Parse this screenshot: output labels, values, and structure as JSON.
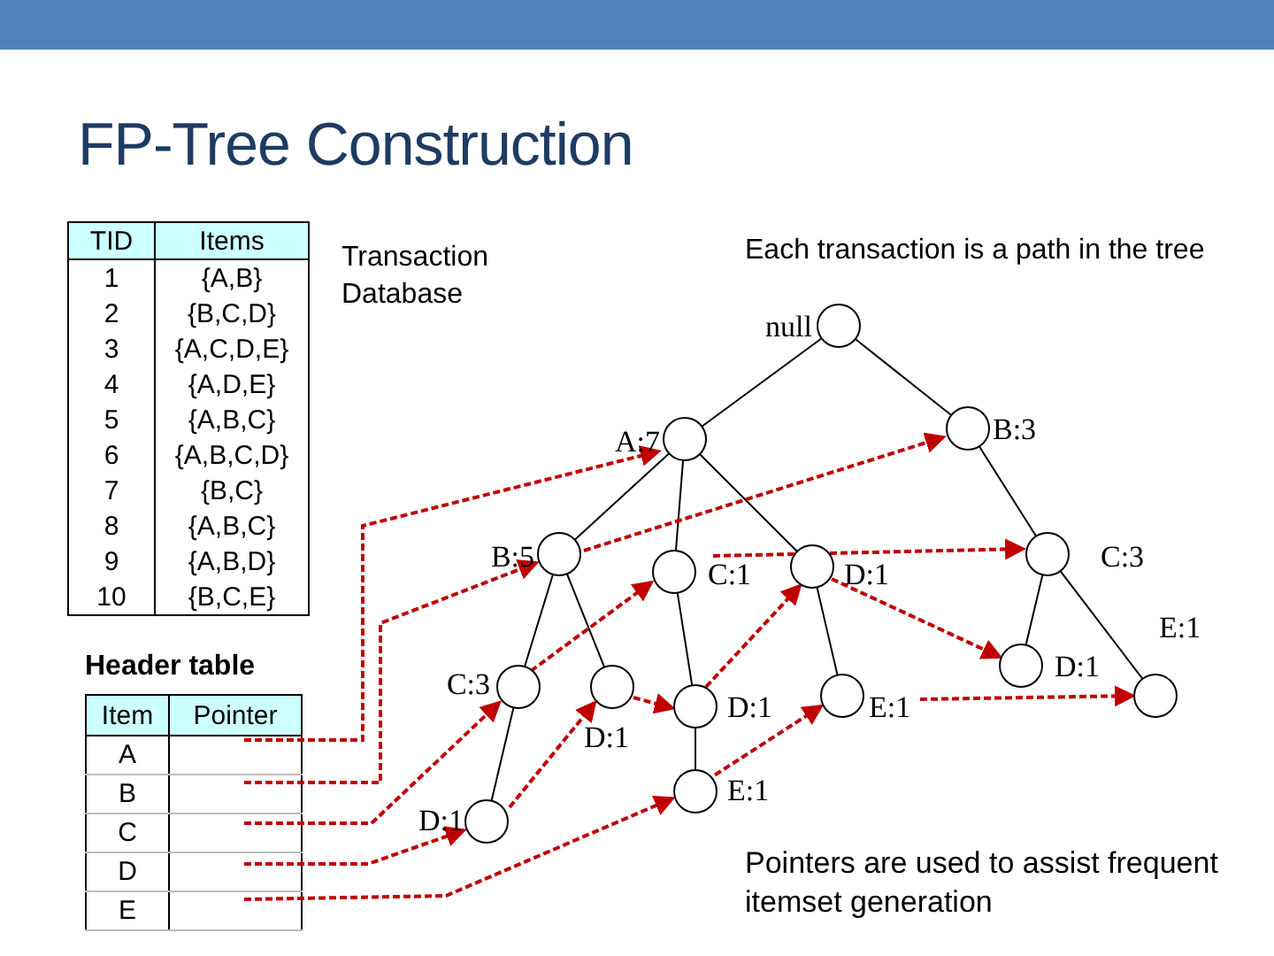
{
  "title": "FP-Tree Construction",
  "transaction_table": {
    "label": "Transaction Database",
    "columns": [
      "TID",
      "Items"
    ],
    "rows": [
      [
        "1",
        "{A,B}"
      ],
      [
        "2",
        "{B,C,D}"
      ],
      [
        "3",
        "{A,C,D,E}"
      ],
      [
        "4",
        "{A,D,E}"
      ],
      [
        "5",
        "{A,B,C}"
      ],
      [
        "6",
        "{A,B,C,D}"
      ],
      [
        "7",
        "{B,C}"
      ],
      [
        "8",
        "{A,B,C}"
      ],
      [
        "9",
        "{A,B,D}"
      ],
      [
        "10",
        "{B,C,E}"
      ]
    ]
  },
  "header_table": {
    "title": "Header table",
    "columns": [
      "Item",
      "Pointer"
    ],
    "items": [
      "A",
      "B",
      "C",
      "D",
      "E"
    ]
  },
  "tree": {
    "caption": "Each transaction is a path in the tree",
    "root": {
      "label": "null",
      "children": [
        {
          "label": "A:7",
          "children": [
            {
              "label": "B:5",
              "children": [
                {
                  "label": "C:3",
                  "children": [
                    {
                      "label": "D:1"
                    }
                  ]
                },
                {
                  "label": "D:1"
                }
              ]
            },
            {
              "label": "C:1",
              "children": [
                {
                  "label": "D:1",
                  "children": [
                    {
                      "label": "E:1"
                    }
                  ]
                }
              ]
            },
            {
              "label": "D:1",
              "children": [
                {
                  "label": "E:1"
                }
              ]
            }
          ]
        },
        {
          "label": "B:3",
          "children": [
            {
              "label": "C:3",
              "children": [
                {
                  "label": "D:1"
                },
                {
                  "label": "E:1"
                }
              ]
            }
          ]
        }
      ]
    }
  },
  "note": "Pointers are used to assist frequent itemset generation"
}
